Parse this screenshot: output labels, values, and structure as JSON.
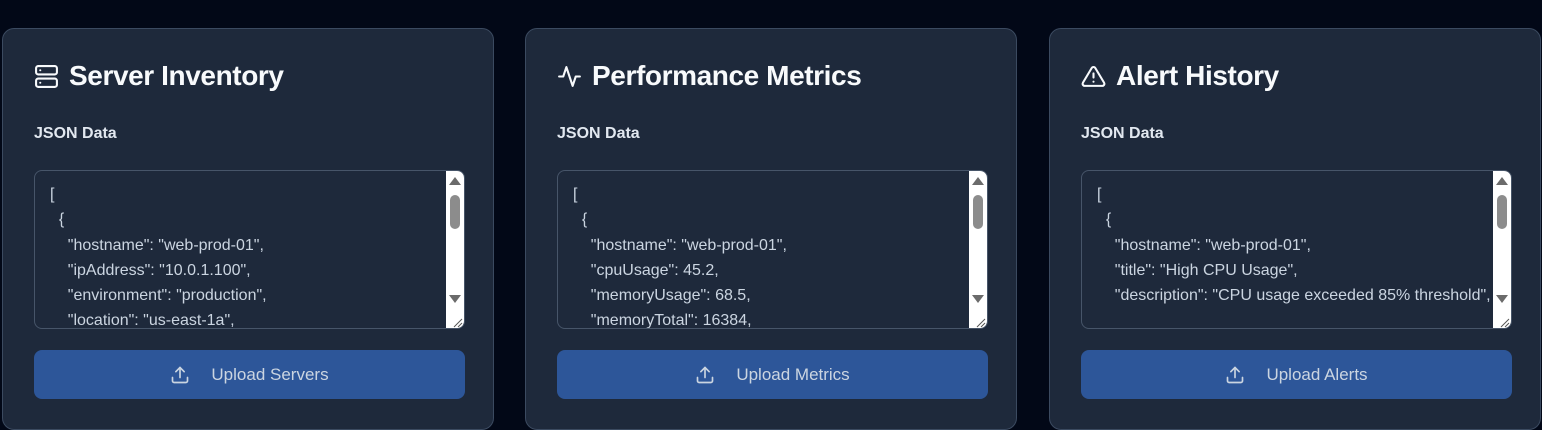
{
  "cards": [
    {
      "title": "Server Inventory",
      "icon": "server-icon",
      "field_label": "JSON Data",
      "json": "[\n  {\n    \"hostname\": \"web-prod-01\",\n    \"ipAddress\": \"10.0.1.100\",\n    \"environment\": \"production\",\n    \"location\": \"us-east-1a\",",
      "button_label": "Upload Servers"
    },
    {
      "title": "Performance Metrics",
      "icon": "activity-icon",
      "field_label": "JSON Data",
      "json": "[\n  {\n    \"hostname\": \"web-prod-01\",\n    \"cpuUsage\": 45.2,\n    \"memoryUsage\": 68.5,\n    \"memoryTotal\": 16384,",
      "button_label": "Upload Metrics"
    },
    {
      "title": "Alert History",
      "icon": "alert-triangle-icon",
      "field_label": "JSON Data",
      "json": "[\n  {\n    \"hostname\": \"web-prod-01\",\n    \"title\": \"High CPU Usage\",\n    \"description\": \"CPU usage exceeded 85% threshold\",",
      "button_label": "Upload Alerts"
    }
  ],
  "colors": {
    "page_background": "#020817",
    "card_background": "#1e293b",
    "button_background": "#2d5699",
    "title_text": "#f8fafc",
    "body_text": "#cbd5e1"
  }
}
